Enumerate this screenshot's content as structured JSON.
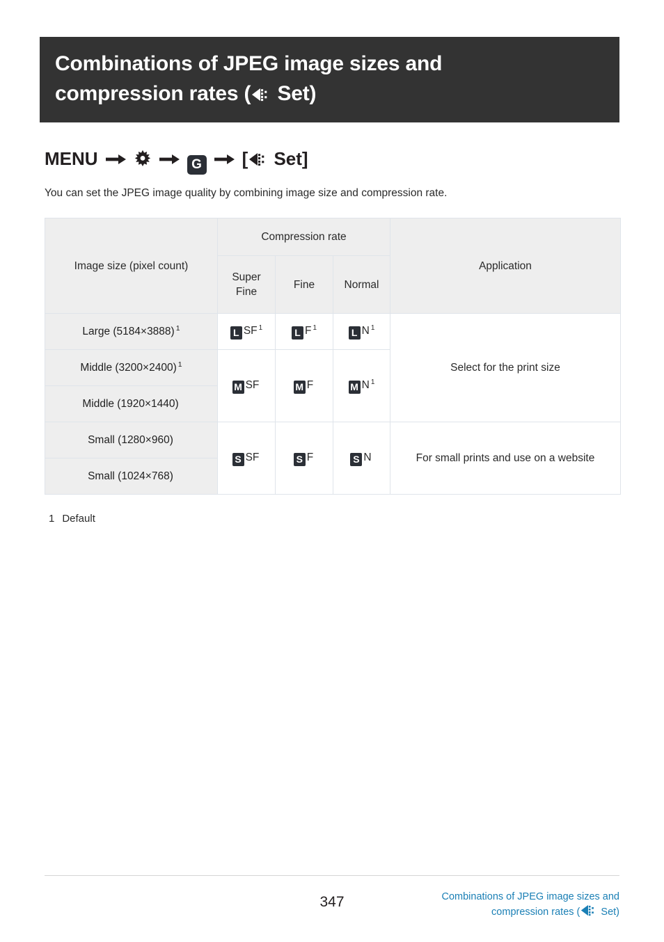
{
  "document": {
    "title_line1": "Combinations of JPEG image sizes and",
    "title_line2_prefix": "compression rates (",
    "title_line2_suffix": " Set)",
    "quality_icon_name": "image-quality-icon"
  },
  "menu_path": {
    "menu_label": "MENU",
    "gear_icon": "gear-icon",
    "arrow_icon": "arrow-right-icon",
    "tab_label": "G",
    "bracket_open": "[",
    "set_label": " Set]"
  },
  "intro": {
    "text": "You can set the JPEG image quality by combining image size and compression rate."
  },
  "table": {
    "headers": {
      "image_size": "Image size (pixel count)",
      "compression_rate": "Compression rate",
      "super_fine_line1": "Super",
      "super_fine_line2": "Fine",
      "fine": "Fine",
      "normal": "Normal",
      "application": "Application"
    },
    "rows": [
      {
        "label": "Large (5184×3888)",
        "label_sup": "1",
        "sf": {
          "badge": "L",
          "text": "SF",
          "sup": "1"
        },
        "f": {
          "badge": "L",
          "text": "F",
          "sup": "1"
        },
        "n": {
          "badge": "L",
          "text": "N",
          "sup": "1"
        }
      },
      {
        "label": "Middle (3200×2400)",
        "label_sup": "1",
        "sf": {
          "badge": "M",
          "text": "SF",
          "sup": ""
        },
        "f": {
          "badge": "M",
          "text": "F",
          "sup": ""
        },
        "n": {
          "badge": "M",
          "text": "N",
          "sup": "1"
        }
      },
      {
        "label": "Middle (1920×1440)",
        "label_sup": ""
      },
      {
        "label": "Small (1280×960)",
        "label_sup": "",
        "sf": {
          "badge": "S",
          "text": "SF",
          "sup": ""
        },
        "f": {
          "badge": "S",
          "text": "F",
          "sup": ""
        },
        "n": {
          "badge": "S",
          "text": "N",
          "sup": ""
        }
      },
      {
        "label": "Small (1024×768)",
        "label_sup": ""
      }
    ],
    "applications": [
      "Select for the print size",
      "For small prints and use on a website"
    ]
  },
  "footnote": {
    "number": "1",
    "text": "Default"
  },
  "footer": {
    "page_number": "347",
    "link_line1": "Combinations of JPEG image sizes and",
    "link_line2_prefix": "compression rates (",
    "link_line2_suffix": " Set)",
    "link_color": "#1a7fb5"
  },
  "colors": {
    "banner_bg": "#333333",
    "header_bg": "#eeeeee",
    "border": "#dfe4ea",
    "badge_bg": "#2b2f36",
    "text": "#231f20"
  }
}
